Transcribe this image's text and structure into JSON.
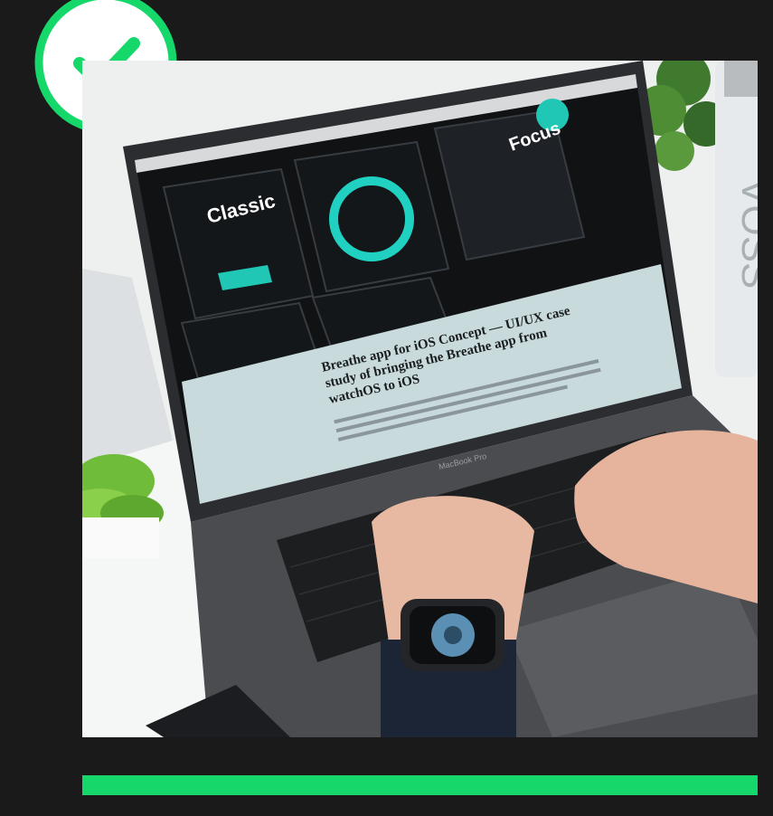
{
  "photo": {
    "article_title": [
      "Breathe app for iOS Concept — UI/UX case",
      "study of bringing the Breathe app from",
      "watchOS to iOS"
    ],
    "screen_word_classic": "Classic",
    "screen_word_focus": "Focus",
    "laptop_label": "MacBook Pro",
    "bottle_label": "VOSS"
  },
  "colors": {
    "accent": "#16d86a",
    "background": "#1a1a1a"
  },
  "icons": {
    "badge": "check-icon"
  }
}
